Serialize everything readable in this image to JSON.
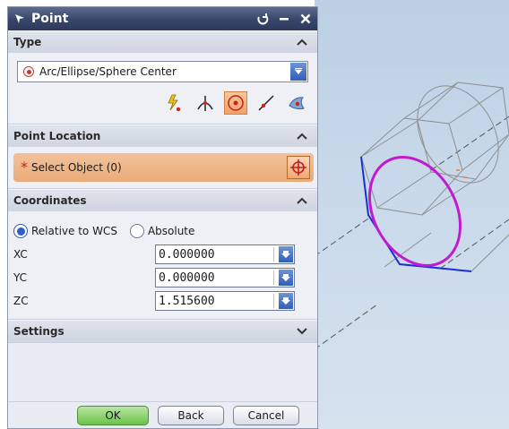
{
  "dialog": {
    "title": "Point",
    "icons": {
      "title": "point-dialog-icon",
      "reset": "reset-icon",
      "minimize": "minimize-icon",
      "close": "close-icon"
    }
  },
  "type_section": {
    "header": "Type",
    "selected": "Arc/Ellipse/Sphere Center",
    "tools": [
      "inferred-point-icon",
      "intersection-point-icon",
      "arc-center-icon",
      "point-on-curve-icon",
      "point-on-surface-icon"
    ]
  },
  "location_section": {
    "header": "Point Location",
    "select_label": "Select Object (0)",
    "required_mark": "*"
  },
  "coords_section": {
    "header": "Coordinates",
    "relative_label": "Relative to WCS",
    "absolute_label": "Absolute",
    "selected_mode": "Relative to WCS",
    "xc_label": "XC",
    "xc_value": "0.000000",
    "yc_label": "YC",
    "yc_value": "0.000000",
    "zc_label": "ZC",
    "zc_value": "1.515600"
  },
  "settings_section": {
    "header": "Settings"
  },
  "buttons": {
    "ok": "OK",
    "back": "Back",
    "cancel": "Cancel"
  },
  "colors": {
    "title_bar": "#38456a",
    "highlight": "#f1a366",
    "ok_button": "#6cc24a",
    "ellipse": "#c21ad0",
    "edge": "#1b2fd8"
  }
}
